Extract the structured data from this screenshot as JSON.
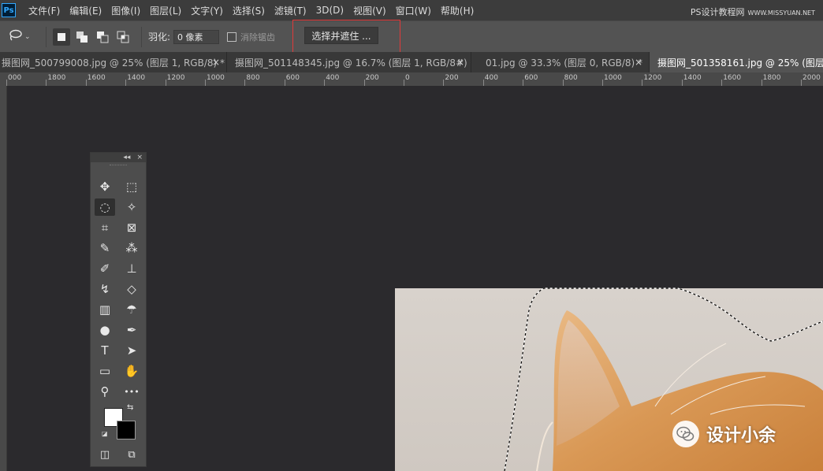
{
  "app": {
    "logo_text": "Ps"
  },
  "menu": [
    {
      "label": "文件(F)"
    },
    {
      "label": "编辑(E)"
    },
    {
      "label": "图像(I)"
    },
    {
      "label": "图层(L)"
    },
    {
      "label": "文字(Y)"
    },
    {
      "label": "选择(S)"
    },
    {
      "label": "滤镜(T)"
    },
    {
      "label": "3D(D)"
    },
    {
      "label": "视图(V)"
    },
    {
      "label": "窗口(W)"
    },
    {
      "label": "帮助(H)"
    }
  ],
  "watermark_top": {
    "text": "PS设计教程网",
    "sub": "WWW.MISSYUAN.NET"
  },
  "options": {
    "tool_icon": "lasso-icon",
    "feather_label": "羽化:",
    "feather_value": "0 像素",
    "antialias_label": "消除锯齿",
    "antialias_checked": false,
    "select_mask_label": "选择并遮住 ..."
  },
  "tabs": [
    {
      "label": "摄图网_500799008.jpg @ 25% (图层 1, RGB/8) *",
      "close": "×",
      "active": false
    },
    {
      "label": "摄图网_501148345.jpg @ 16.7% (图层 1, RGB/8#) *",
      "close": "×",
      "active": false
    },
    {
      "label": "01.jpg @ 33.3% (图层 0, RGB/8) *",
      "close": "×",
      "active": false
    },
    {
      "label": "摄图网_501358161.jpg @ 25% (图层",
      "close": "",
      "active": true
    }
  ],
  "ruler": {
    "labels": [
      "000",
      "1800",
      "1600",
      "1400",
      "1200",
      "1000",
      "800",
      "600",
      "400",
      "200",
      "0",
      "200",
      "400",
      "600",
      "800",
      "1000",
      "1200",
      "1400",
      "1600",
      "1800",
      "2000"
    ]
  },
  "toolbox": {
    "header_collapse": "◂◂",
    "header_close": "×",
    "tools": [
      {
        "name": "move-icon",
        "glyph": "✥"
      },
      {
        "name": "rect-marquee-icon",
        "glyph": "⬚"
      },
      {
        "name": "lasso-icon",
        "glyph": "◌",
        "active": true
      },
      {
        "name": "magic-wand-icon",
        "glyph": "✧"
      },
      {
        "name": "crop-icon",
        "glyph": "⌗"
      },
      {
        "name": "frame-icon",
        "glyph": "⊠"
      },
      {
        "name": "eyedropper-icon",
        "glyph": "✎"
      },
      {
        "name": "spot-healing-icon",
        "glyph": "⁂"
      },
      {
        "name": "brush-icon",
        "glyph": "✐"
      },
      {
        "name": "stamp-icon",
        "glyph": "⊥"
      },
      {
        "name": "history-brush-icon",
        "glyph": "↯"
      },
      {
        "name": "eraser-icon",
        "glyph": "◇"
      },
      {
        "name": "gradient-icon",
        "glyph": "▥"
      },
      {
        "name": "smudge-icon",
        "glyph": "☂"
      },
      {
        "name": "dodge-icon",
        "glyph": "●"
      },
      {
        "name": "pen-icon",
        "glyph": "✒"
      },
      {
        "name": "type-icon",
        "glyph": "T"
      },
      {
        "name": "path-select-icon",
        "glyph": "➤"
      },
      {
        "name": "rectangle-icon",
        "glyph": "▭"
      },
      {
        "name": "hand-icon",
        "glyph": "✋"
      },
      {
        "name": "zoom-icon",
        "glyph": "⚲"
      },
      {
        "name": "more-tools-icon",
        "glyph": "•••"
      },
      {
        "name": "quick-mask-icon",
        "glyph": "◫"
      },
      {
        "name": "screen-mode-icon",
        "glyph": "⧉"
      }
    ],
    "swap_glyph": "⇆",
    "default_glyph": "◪",
    "fg_color": "#ffffff",
    "bg_color": "#000000"
  },
  "wechat_watermark": {
    "text": "设计小余"
  }
}
